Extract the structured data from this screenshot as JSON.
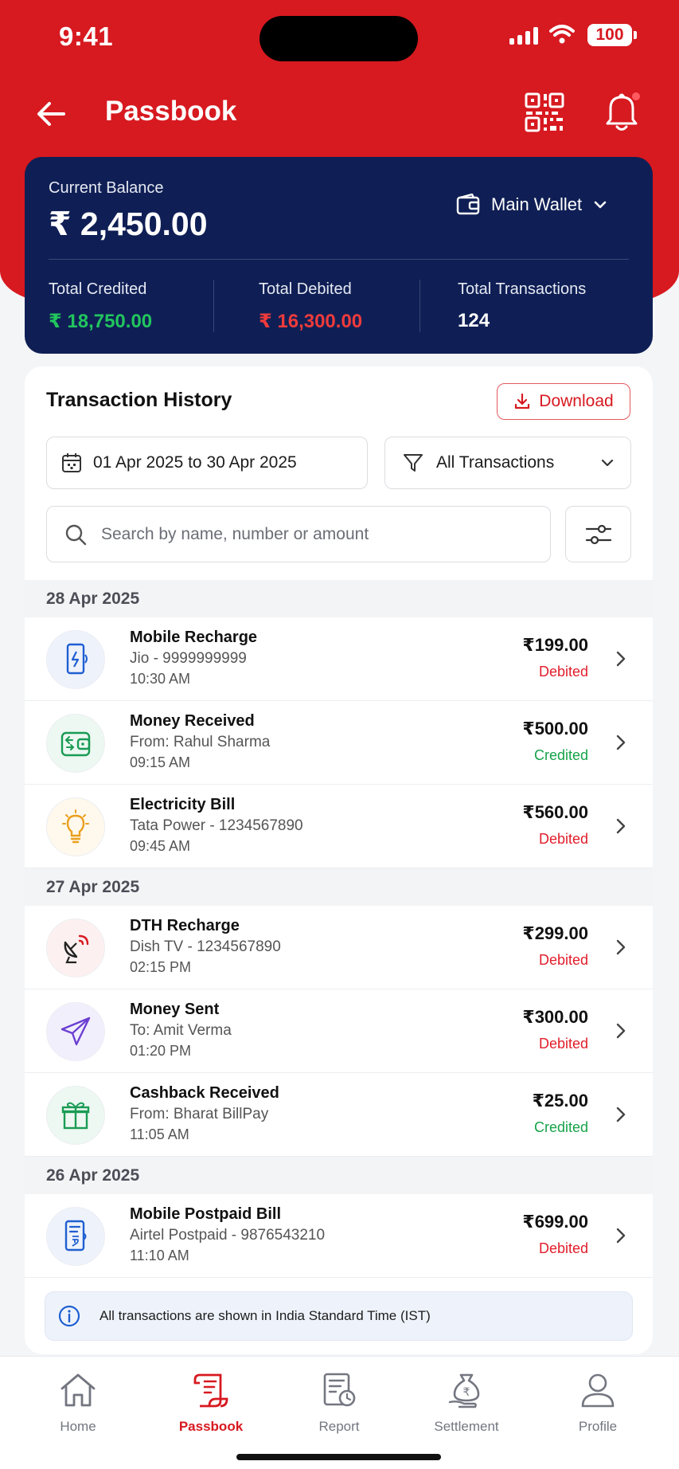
{
  "status": {
    "time": "9:41",
    "battery": "100"
  },
  "header": {
    "title": "Passbook"
  },
  "balance": {
    "label": "Current Balance",
    "amount": "₹ 2,450.00",
    "wallet": "Main Wallet",
    "stats": [
      {
        "label": "Total Credited",
        "value": "₹ 18,750.00",
        "color": "#22c55e"
      },
      {
        "label": "Total Debited",
        "value": "₹ 16,300.00",
        "color": "#ef3b3b"
      },
      {
        "label": "Total Transactions",
        "value": "124",
        "color": "#ffffff"
      }
    ]
  },
  "history": {
    "title": "Transaction History",
    "download_label": "Download",
    "date_range": "01 Apr 2025 to 30 Apr 2025",
    "filter": "All Transactions",
    "search_placeholder": "Search by name, number or amount",
    "groups": [
      {
        "date": "28 Apr 2025",
        "items": [
          {
            "name": "Mobile Recharge",
            "sub": "Jio - 9999999999",
            "time": "10:30 AM",
            "amount": "₹199.00",
            "status": "Debited",
            "icon": "mobile-recharge-icon"
          },
          {
            "name": "Money Received",
            "sub": "From: Rahul Sharma",
            "time": "09:15 AM",
            "amount": "₹500.00",
            "status": "Credited",
            "icon": "wallet-icon"
          },
          {
            "name": "Electricity Bill",
            "sub": "Tata Power - 1234567890",
            "time": "09:45 AM",
            "amount": "₹560.00",
            "status": "Debited",
            "icon": "lightbulb-icon"
          }
        ]
      },
      {
        "date": "27 Apr 2025",
        "items": [
          {
            "name": "DTH Recharge",
            "sub": "Dish TV - 1234567890",
            "time": "02:15 PM",
            "amount": "₹299.00",
            "status": "Debited",
            "icon": "satellite-dish-icon"
          },
          {
            "name": "Money Sent",
            "sub": "To: Amit Verma",
            "time": "01:20 PM",
            "amount": "₹300.00",
            "status": "Debited",
            "icon": "paper-plane-icon"
          },
          {
            "name": "Cashback Received",
            "sub": "From: Bharat BillPay",
            "time": "11:05 AM",
            "amount": "₹25.00",
            "status": "Credited",
            "icon": "gift-icon"
          }
        ]
      },
      {
        "date": "26 Apr 2025",
        "items": [
          {
            "name": "Mobile Postpaid Bill",
            "sub": "Airtel Postpaid - 9876543210",
            "time": "11:10 AM",
            "amount": "₹699.00",
            "status": "Debited",
            "icon": "postpaid-bill-icon"
          }
        ]
      }
    ],
    "info": "All transactions are shown in India Standard Time (IST)"
  },
  "nav": [
    {
      "label": "Home",
      "icon": "home-icon",
      "active": false
    },
    {
      "label": "Passbook",
      "icon": "passbook-icon",
      "active": true
    },
    {
      "label": "Report",
      "icon": "report-icon",
      "active": false
    },
    {
      "label": "Settlement",
      "icon": "settlement-icon",
      "active": false
    },
    {
      "label": "Profile",
      "icon": "profile-icon",
      "active": false
    }
  ],
  "colors": {
    "brand_red": "#d71920",
    "navy": "#0f1f55",
    "credit_green": "#16a34a",
    "debit_red": "#e11d2a"
  }
}
